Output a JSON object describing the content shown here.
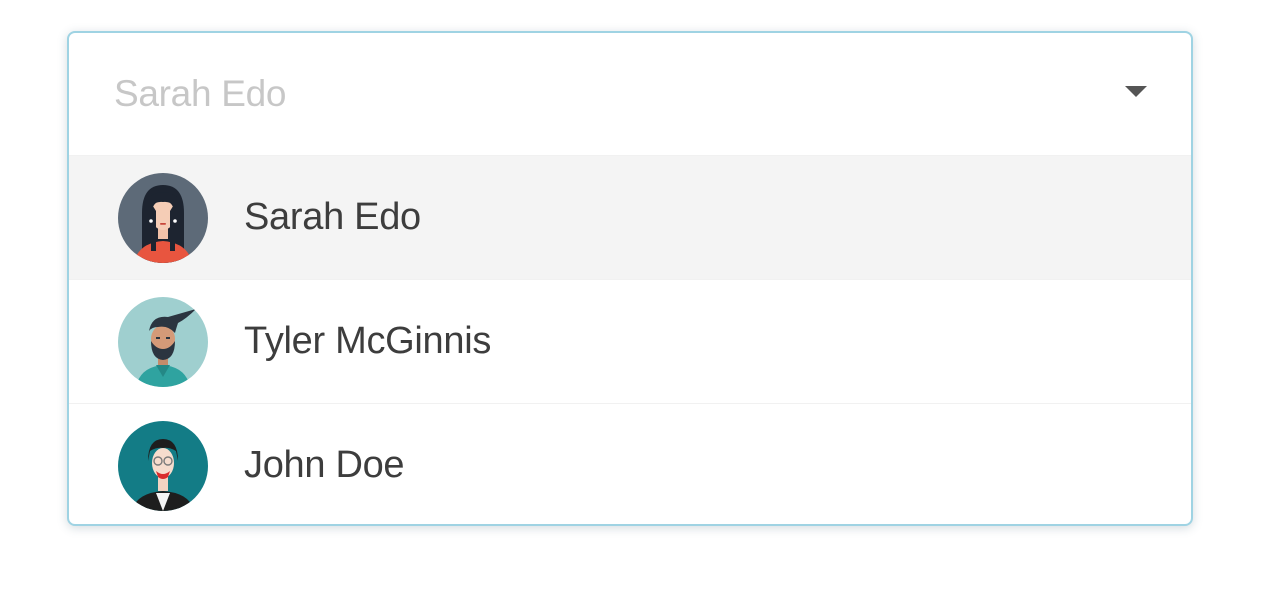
{
  "select": {
    "selected_value": "Sarah Edo",
    "options": [
      {
        "label": "Sarah Edo",
        "avatar": "woman-long-dark-hair-avatar",
        "highlighted": true
      },
      {
        "label": "Tyler McGinnis",
        "avatar": "bearded-man-avatar",
        "highlighted": false
      },
      {
        "label": "John Doe",
        "avatar": "woman-glasses-avatar",
        "highlighted": false
      }
    ]
  },
  "colors": {
    "border": "#9fd3e3",
    "highlight": "#f4f4f4",
    "placeholder_text": "#c7c7c7",
    "option_text": "#3d3d3d"
  }
}
